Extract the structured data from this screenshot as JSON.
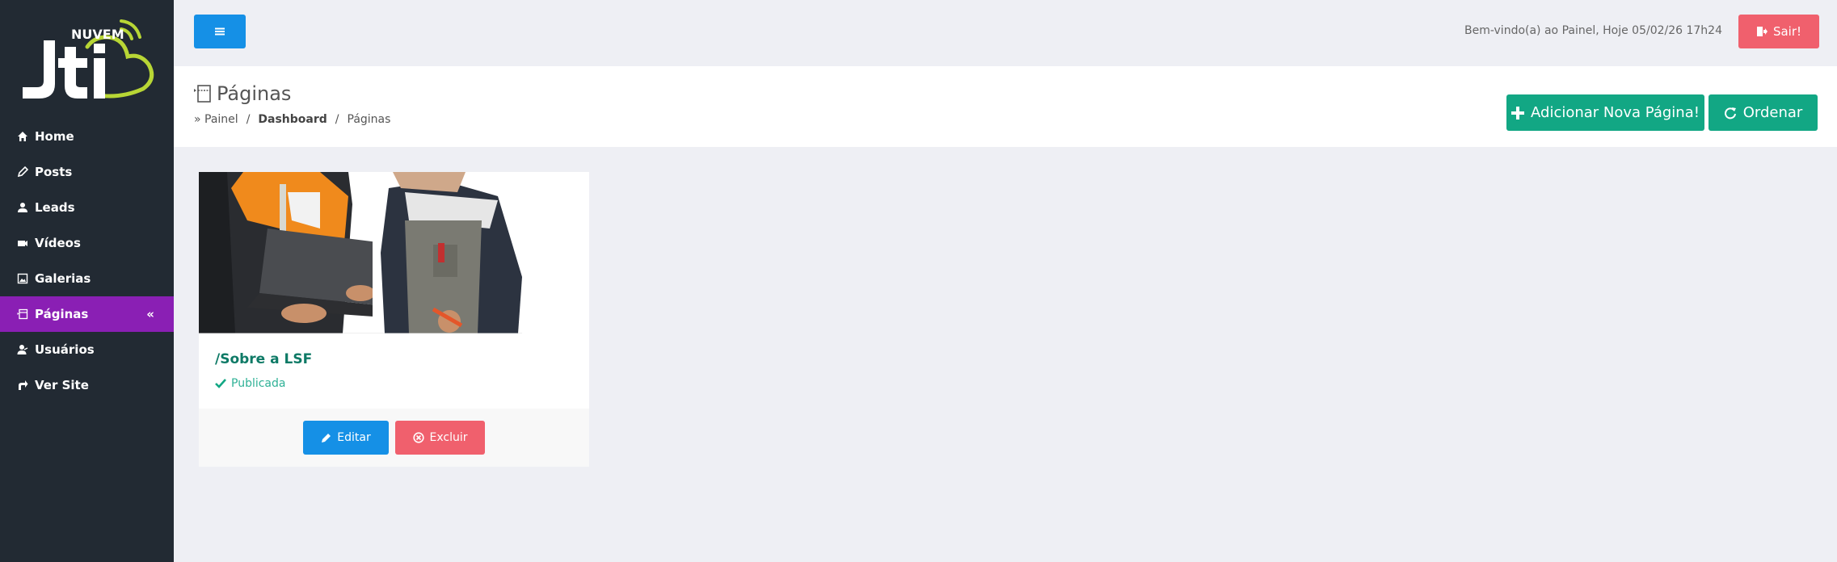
{
  "brand": {
    "logo_text": "Jti",
    "logo_subtext": "NUVEM",
    "accent_color": "#b8d635"
  },
  "sidebar": {
    "items": [
      {
        "label": "Home",
        "icon": "home-icon"
      },
      {
        "label": "Posts",
        "icon": "pen-icon"
      },
      {
        "label": "Leads",
        "icon": "user-icon"
      },
      {
        "label": "Vídeos",
        "icon": "video-icon"
      },
      {
        "label": "Galerias",
        "icon": "image-icon"
      },
      {
        "label": "Páginas",
        "icon": "page-icon",
        "active": true,
        "collapse_glyph": "«"
      },
      {
        "label": "Usuários",
        "icon": "users-icon"
      },
      {
        "label": "Ver Site",
        "icon": "share-icon"
      }
    ],
    "active_color": "#8a1fb4"
  },
  "topbar": {
    "welcome_text": "Bem-vindo(a) ao Painel, Hoje 05/02/26 17h24",
    "logout_label": "Sair!"
  },
  "header": {
    "title": "Páginas",
    "breadcrumb": {
      "prefix": "» Painel",
      "sep1": "/",
      "middle": "Dashboard",
      "sep2": "/",
      "current": "Páginas"
    },
    "add_button_label": "Adicionar Nova Página!",
    "order_button_label": "Ordenar"
  },
  "pages": [
    {
      "title": "/Sobre a LSF",
      "status": "Publicada",
      "edit_label": "Editar",
      "delete_label": "Excluir"
    }
  ],
  "colors": {
    "primary": "#1590e6",
    "danger": "#f0606d",
    "success": "#12a784"
  }
}
